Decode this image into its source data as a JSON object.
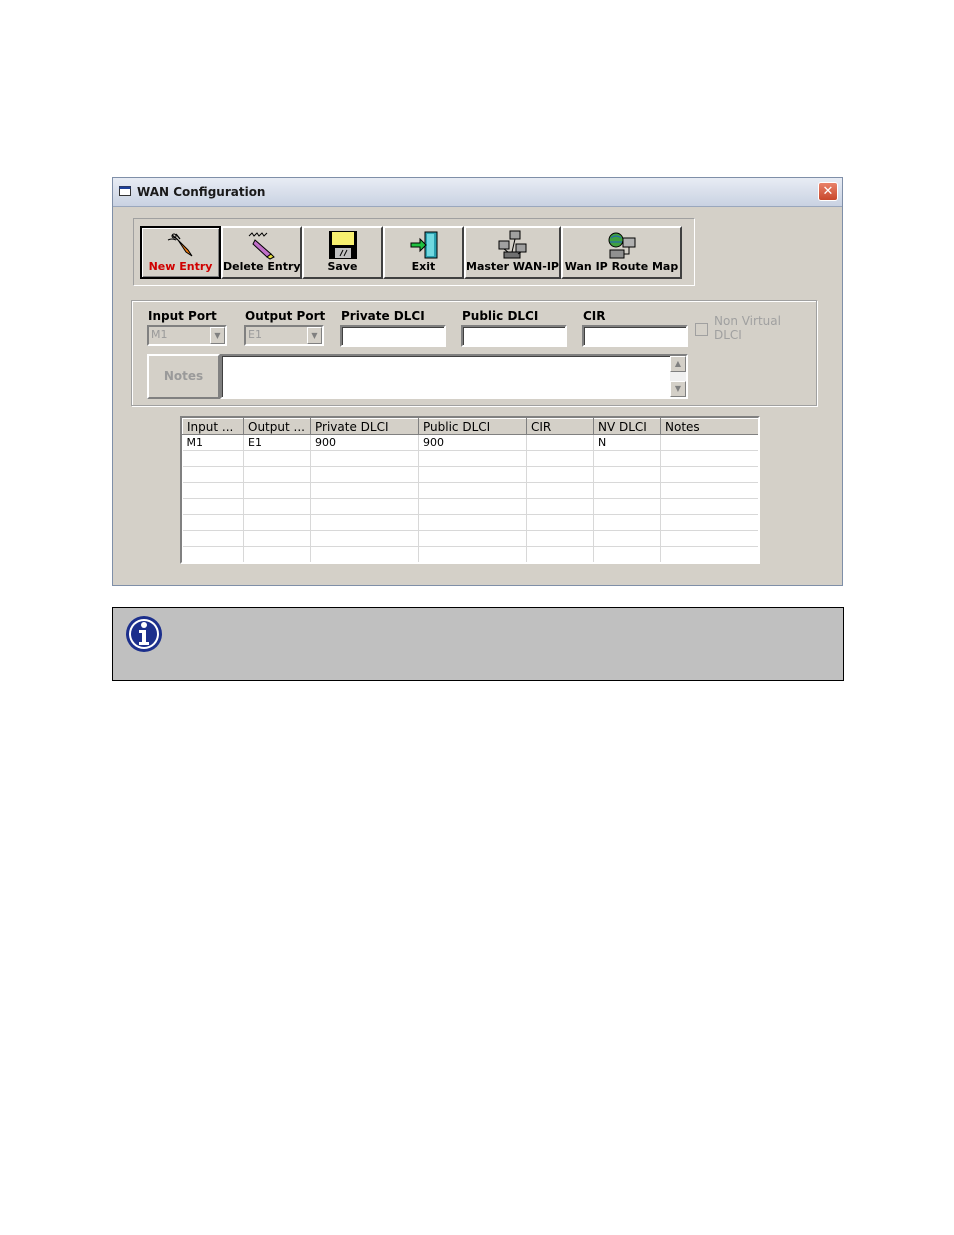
{
  "window": {
    "title": "WAN Configuration",
    "close_glyph": "✕"
  },
  "toolbar": {
    "buttons": [
      {
        "label": "New Entry",
        "icon": "new-entry-icon",
        "active": true
      },
      {
        "label": "Delete Entry",
        "icon": "delete-entry-icon"
      },
      {
        "label": "Save",
        "icon": "save-icon"
      },
      {
        "label": "Exit",
        "icon": "exit-icon"
      },
      {
        "label": "Master WAN-IP",
        "icon": "network-computers-icon"
      },
      {
        "label": "Wan IP Route Map",
        "icon": "route-map-icon"
      }
    ]
  },
  "form": {
    "input_port": {
      "label": "Input Port",
      "value": "M1"
    },
    "output_port": {
      "label": "Output Port",
      "value": "E1"
    },
    "private_dlci": {
      "label": "Private DLCI",
      "value": ""
    },
    "public_dlci": {
      "label": "Public DLCI",
      "value": ""
    },
    "cir": {
      "label": "CIR",
      "value": ""
    },
    "non_virtual_dlci": {
      "label": "Non Virtual DLCI",
      "checked": false
    },
    "notes_button": "Notes",
    "notes_value": ""
  },
  "grid": {
    "columns": [
      "Input ...",
      "Output ...",
      "Private DLCI",
      "Public DLCI",
      "CIR",
      "NV DLCI",
      "Notes"
    ],
    "rows": [
      [
        "M1",
        "E1",
        "900",
        "900",
        "",
        "N",
        ""
      ],
      [
        "",
        "",
        "",
        "",
        "",
        "",
        ""
      ],
      [
        "",
        "",
        "",
        "",
        "",
        "",
        ""
      ],
      [
        "",
        "",
        "",
        "",
        "",
        "",
        ""
      ],
      [
        "",
        "",
        "",
        "",
        "",
        "",
        ""
      ],
      [
        "",
        "",
        "",
        "",
        "",
        "",
        ""
      ],
      [
        "",
        "",
        "",
        "",
        "",
        "",
        ""
      ],
      [
        "",
        "",
        "",
        "",
        "",
        "",
        ""
      ]
    ]
  },
  "note_box": {
    "icon": "info-icon",
    "text": ""
  },
  "colors": {
    "dialog_bg": "#d4d0c8",
    "active_label": "#d00000",
    "note_bg": "#c0c0c0",
    "info_blue": "#1c2f8c"
  }
}
